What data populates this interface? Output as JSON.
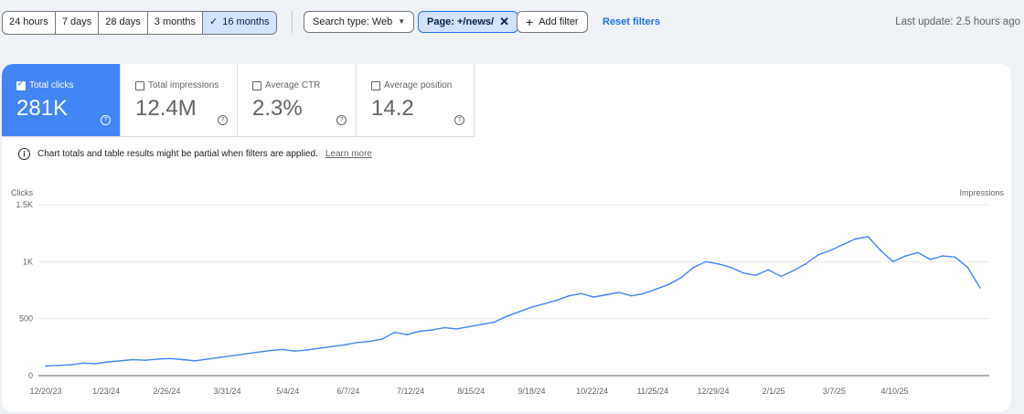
{
  "date_ranges": [
    "24 hours",
    "7 days",
    "28 days",
    "3 months",
    "16 months"
  ],
  "date_range_selected": "16 months",
  "search_type_chip": "Search type: Web",
  "page_filter_chip": "Page: +/news/",
  "add_filter": "Add filter",
  "reset_filters": "Reset filters",
  "last_update": "Last update: 2.5 hours ago",
  "metrics": [
    {
      "label": "Total clicks",
      "value": "281K",
      "selected": true
    },
    {
      "label": "Total impressions",
      "value": "12.4M",
      "selected": false
    },
    {
      "label": "Average CTR",
      "value": "2.3%",
      "selected": false
    },
    {
      "label": "Average position",
      "value": "14.2",
      "selected": false
    }
  ],
  "notice": "Chart totals and table results might be partial when filters are applied.",
  "learn_more": "Learn more",
  "colors": {
    "accent": "#1a73e8",
    "clicks_series": "#4285f4",
    "chip_selected": "#d3e3fd"
  },
  "chart_data": {
    "type": "line",
    "ylabel": "Clicks",
    "y2label": "Impressions",
    "ylim": [
      0,
      1500
    ],
    "yticks": [
      "1.5K",
      "1K",
      "500",
      "0"
    ],
    "x_tick_labels": [
      "12/20/23",
      "1/23/24",
      "2/26/24",
      "3/31/24",
      "5/4/24",
      "6/7/24",
      "7/12/24",
      "8/15/24",
      "9/18/24",
      "10/22/24",
      "11/25/24",
      "12/29/24",
      "2/1/25",
      "3/7/25",
      "4/10/25"
    ],
    "series": [
      {
        "name": "Clicks",
        "x_start": "2023-12-20",
        "x_step_days": 7,
        "values": [
          85,
          90,
          95,
          110,
          105,
          120,
          130,
          140,
          135,
          145,
          150,
          140,
          130,
          145,
          160,
          175,
          190,
          205,
          220,
          230,
          215,
          225,
          240,
          255,
          270,
          290,
          300,
          320,
          380,
          360,
          390,
          400,
          420,
          410,
          430,
          450,
          470,
          520,
          560,
          600,
          630,
          660,
          700,
          720,
          690,
          710,
          730,
          700,
          720,
          760,
          800,
          860,
          950,
          1000,
          980,
          950,
          900,
          880,
          930,
          870,
          920,
          980,
          1060,
          1100,
          1150,
          1200,
          1220,
          1100,
          1000,
          1050,
          1080,
          1020,
          1050,
          1040,
          950,
          770
        ]
      }
    ]
  }
}
